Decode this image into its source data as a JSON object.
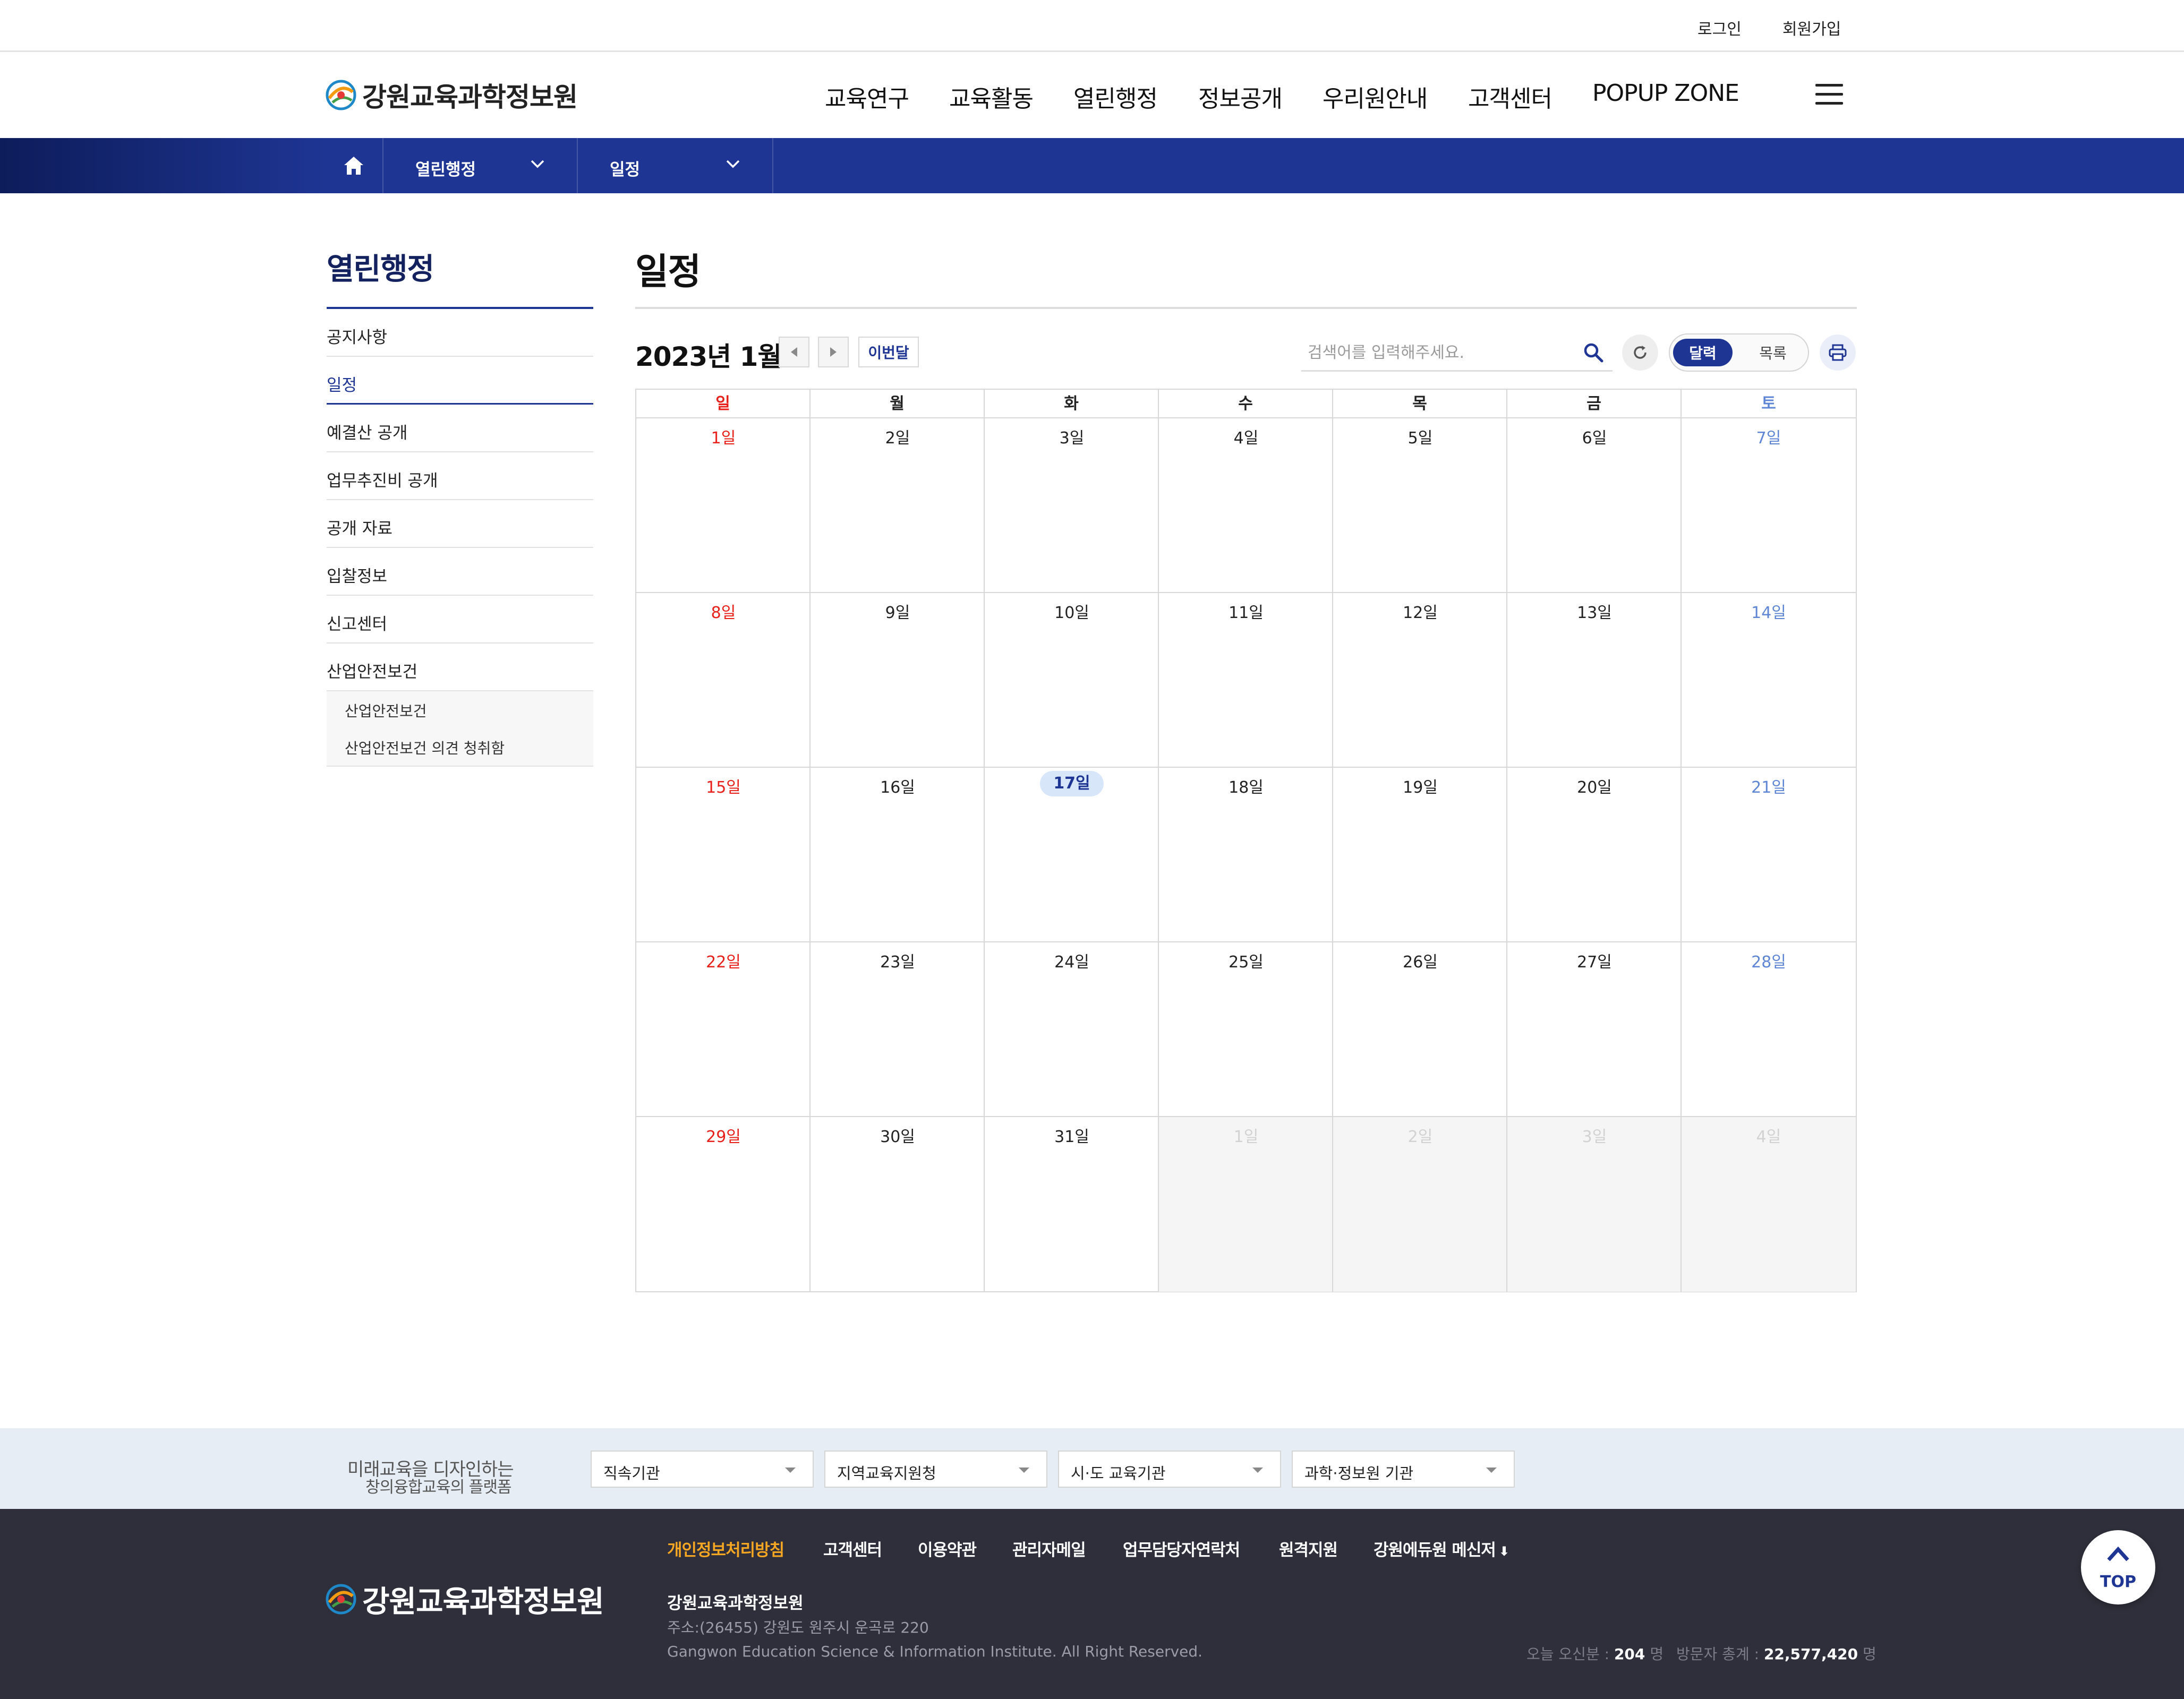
{
  "util": {
    "login": "로그인",
    "join": "회원가입"
  },
  "header": {
    "logo_text": "강원교육과학정보원",
    "nav": [
      "교육연구",
      "교육활동",
      "열린행정",
      "정보공개",
      "우리원안내",
      "고객센터",
      "POPUP ZONE"
    ]
  },
  "breadcrumb": {
    "level1": "열린행정",
    "level2": "일정"
  },
  "sidebar": {
    "title": "열린행정",
    "items": [
      "공지사항",
      "일정",
      "예결산 공개",
      "업무추진비 공개",
      "공개 자료",
      "입찰정보",
      "신고센터",
      "산업안전보건"
    ],
    "active_index": 1,
    "sub_items": [
      "산업안전보건",
      "산업안전보건 의견 청취함"
    ]
  },
  "main": {
    "title": "일정",
    "month_title": "2023년 1월",
    "this_month": "이번달",
    "search_placeholder": "검색어를 입력해주세요.",
    "view_calendar": "달력",
    "view_list": "목록"
  },
  "calendar": {
    "dow": [
      "일",
      "월",
      "화",
      "수",
      "목",
      "금",
      "토"
    ],
    "today": "17일",
    "weeks": [
      [
        "1일",
        "2일",
        "3일",
        "4일",
        "5일",
        "6일",
        "7일"
      ],
      [
        "8일",
        "9일",
        "10일",
        "11일",
        "12일",
        "13일",
        "14일"
      ],
      [
        "15일",
        "16일",
        "17일",
        "18일",
        "19일",
        "20일",
        "21일"
      ],
      [
        "22일",
        "23일",
        "24일",
        "25일",
        "26일",
        "27일",
        "28일"
      ],
      [
        "29일",
        "30일",
        "31일",
        "1일",
        "2일",
        "3일",
        "4일"
      ]
    ],
    "colors": {
      "sunday": "#e8201a",
      "saturday": "#5e86d4",
      "today_bg": "#d8e6fa"
    }
  },
  "footer": {
    "slogan_line1": "미래교육을 디자인하는",
    "slogan_line2": "창의융합교육의 플랫폼",
    "selects": [
      "직속기관",
      "지역교육지원청",
      "시·도 교육기관",
      "과학·정보원 기관"
    ],
    "links": [
      "개인정보처리방침",
      "고객센터",
      "이용약관",
      "관리자메일",
      "업무담당자연락처",
      "원격지원",
      "강원에듀원 메신저"
    ],
    "logo_text": "강원교육과학정보원",
    "org": "강원교육과학정보원",
    "address": "주소:(26455) 강원도 원주시 운곡로 220",
    "copyright": "Gangwon Education Science & Information Institute. All Right Reserved.",
    "today_label": "오늘 오신분 :",
    "today_value": "204",
    "total_label": "방문자 총계 :",
    "total_value": "22,577,420",
    "unit": "명",
    "top_label": "TOP"
  },
  "colors": {
    "primary": "#1e3593",
    "footer_bg": "#2e2f3a",
    "accent": "#f5a623"
  }
}
